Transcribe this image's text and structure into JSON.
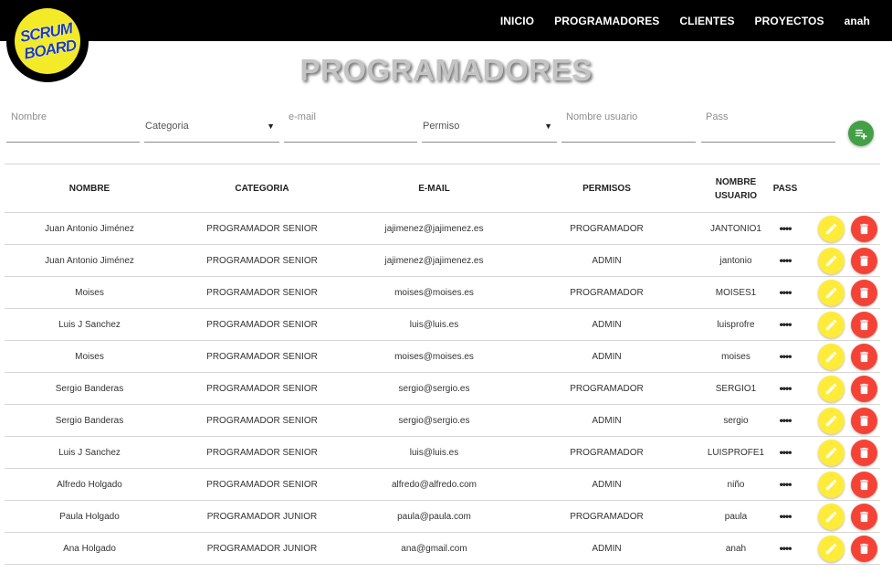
{
  "logo": {
    "line1": "SCRUM",
    "line2": "BOARD"
  },
  "nav": {
    "items": [
      "INICIO",
      "PROGRAMADORES",
      "CLIENTES",
      "PROYECTOS"
    ],
    "user": "anah"
  },
  "page": {
    "title": "PROGRAMADORES"
  },
  "filters": {
    "nombre_placeholder": "Nombre",
    "categoria_label": "Categoria",
    "email_placeholder": "e-mail",
    "permiso_label": "Permiso",
    "usuario_placeholder": "Nombre usuario",
    "pass_placeholder": "Pass"
  },
  "table": {
    "headers": {
      "nombre": "NOMBRE",
      "categoria": "CATEGORIA",
      "email": "E-MAIL",
      "permisos": "PERMISOS",
      "usuario_line1": "NOMBRE",
      "usuario_line2": "USUARIO",
      "pass": "PASS"
    },
    "pass_mask": "••••",
    "rows": [
      {
        "nombre": "Juan Antonio Jiménez",
        "categoria": "PROGRAMADOR SENIOR",
        "email": "jajimenez@jajimenez.es",
        "permiso": "PROGRAMADOR",
        "usuario": "JANTONIO1"
      },
      {
        "nombre": "Juan Antonio Jiménez",
        "categoria": "PROGRAMADOR SENIOR",
        "email": "jajimenez@jajimenez.es",
        "permiso": "ADMIN",
        "usuario": "jantonio"
      },
      {
        "nombre": "Moises",
        "categoria": "PROGRAMADOR SENIOR",
        "email": "moises@moises.es",
        "permiso": "PROGRAMADOR",
        "usuario": "MOISES1"
      },
      {
        "nombre": "Luis J Sanchez",
        "categoria": "PROGRAMADOR SENIOR",
        "email": "luis@luis.es",
        "permiso": "ADMIN",
        "usuario": "luisprofre"
      },
      {
        "nombre": "Moises",
        "categoria": "PROGRAMADOR SENIOR",
        "email": "moises@moises.es",
        "permiso": "ADMIN",
        "usuario": "moises"
      },
      {
        "nombre": "Sergio Banderas",
        "categoria": "PROGRAMADOR SENIOR",
        "email": "sergio@sergio.es",
        "permiso": "PROGRAMADOR",
        "usuario": "SERGIO1"
      },
      {
        "nombre": "Sergio Banderas",
        "categoria": "PROGRAMADOR SENIOR",
        "email": "sergio@sergio.es",
        "permiso": "ADMIN",
        "usuario": "sergio"
      },
      {
        "nombre": "Luis J Sanchez",
        "categoria": "PROGRAMADOR SENIOR",
        "email": "luis@luis.es",
        "permiso": "PROGRAMADOR",
        "usuario": "LUISPROFE1"
      },
      {
        "nombre": "Alfredo Holgado",
        "categoria": "PROGRAMADOR SENIOR",
        "email": "alfredo@alfredo.com",
        "permiso": "ADMIN",
        "usuario": "niño"
      },
      {
        "nombre": "Paula Holgado",
        "categoria": "PROGRAMADOR JUNIOR",
        "email": "paula@paula.com",
        "permiso": "PROGRAMADOR",
        "usuario": "paula"
      },
      {
        "nombre": "Ana Holgado",
        "categoria": "PROGRAMADOR JUNIOR",
        "email": "ana@gmail.com",
        "permiso": "ADMIN",
        "usuario": "anah"
      }
    ]
  },
  "colors": {
    "navbar": "#000000",
    "logo_yellow": "#f3ea28",
    "logo_text": "#1e3fa8",
    "add_button": "#43a047",
    "edit_button": "#ffeb3b",
    "delete_button": "#f44336"
  },
  "icons": {
    "add": "playlist-add-icon",
    "edit": "pencil-icon",
    "delete": "trash-icon",
    "sort": "dropdown-arrow-icon"
  }
}
